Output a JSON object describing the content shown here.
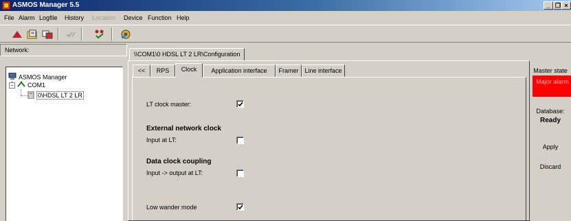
{
  "window": {
    "title": "ASMOS Manager 5.5",
    "controls": {
      "minimize": "_",
      "restore": "❐",
      "close": "×"
    }
  },
  "menu": {
    "items": [
      "File",
      "Alarm",
      "Logfile",
      "History",
      "Location",
      "Device",
      "Function",
      "Help"
    ],
    "disabled": [
      "Location"
    ]
  },
  "toolbar": {
    "buttons": [
      "up-arrow-icon",
      "open-folder-icon",
      "network-icon",
      "check-icon",
      "alarm-list-icon",
      "settings-icon"
    ]
  },
  "network_panel": {
    "label": "Network:",
    "tree": [
      {
        "label": "ASMOS Manager",
        "icon": "computer-icon",
        "level": 0
      },
      {
        "label": "COM1",
        "icon": "serial-port-icon",
        "level": 1,
        "expanded": true
      },
      {
        "label": "0\\HDSL LT 2 LR",
        "icon": "device-icon",
        "level": 2,
        "selected": true
      }
    ]
  },
  "config": {
    "path_tab": "\\\\COM1\\0 HDSL LT 2 LR\\Configuration",
    "tabs": [
      "<<",
      "RPS",
      "Clock",
      "Application interface",
      "Framer",
      "Line interface"
    ],
    "active_tab": "Clock",
    "fields": {
      "lt_clock_master": {
        "label": "LT clock master:",
        "checked": true
      },
      "external_clock_heading": "External network clock",
      "input_at_lt": {
        "label": "Input at LT:",
        "checked": false
      },
      "data_clock_heading": "Data clock coupling",
      "input_output_lt": {
        "label": "Input -> output at LT:",
        "checked": false
      },
      "low_wander": {
        "label": "Low wander mode",
        "checked": true
      }
    }
  },
  "side": {
    "master_state_label": "Master state",
    "master_state_value": "Major alarm",
    "database_label": "Database:",
    "database_value": "Ready",
    "apply_label": "Apply",
    "discard_label": "Discard",
    "alarm_color": "#ff0000"
  }
}
